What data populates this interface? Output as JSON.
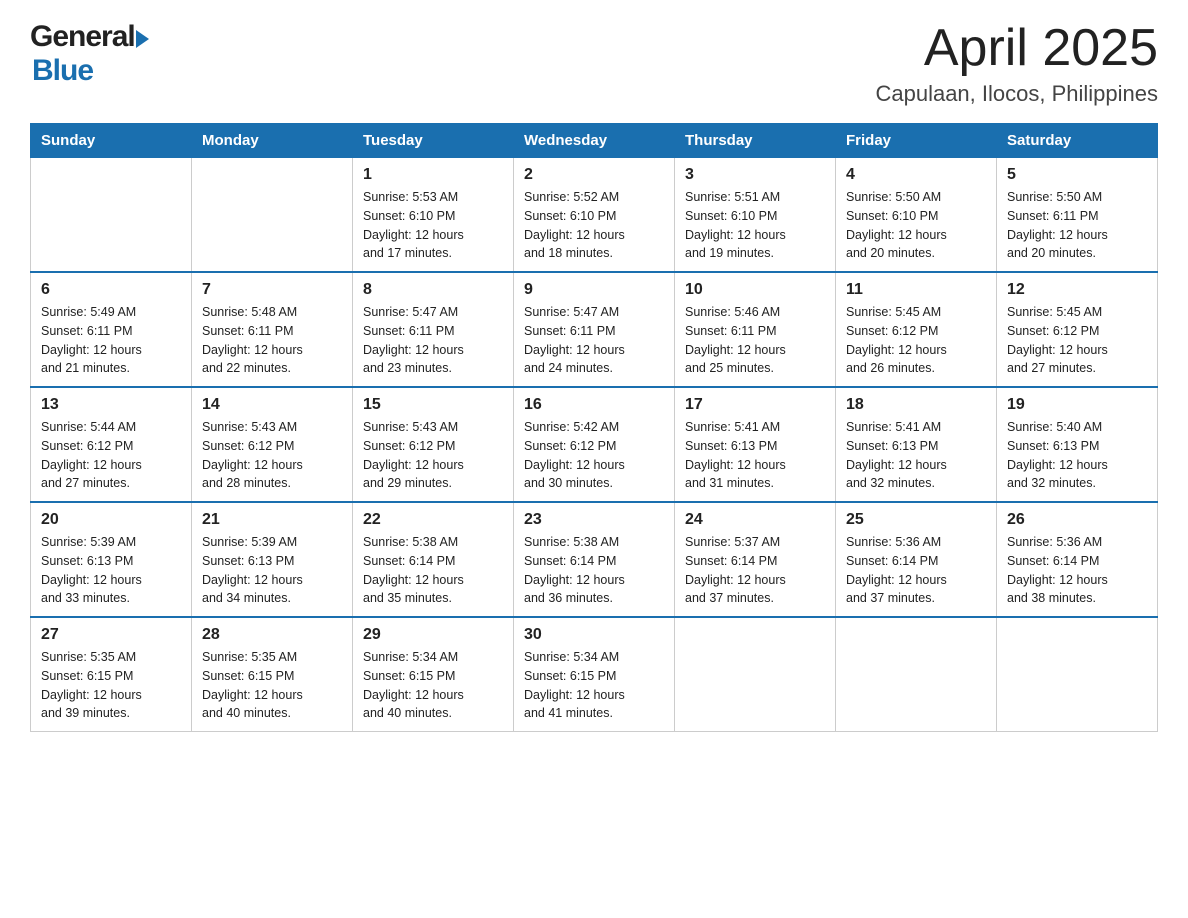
{
  "header": {
    "logo_general": "General",
    "logo_blue": "Blue",
    "title": "April 2025",
    "location": "Capulaan, Ilocos, Philippines"
  },
  "days_of_week": [
    "Sunday",
    "Monday",
    "Tuesday",
    "Wednesday",
    "Thursday",
    "Friday",
    "Saturday"
  ],
  "weeks": [
    [
      {
        "day": "",
        "info": ""
      },
      {
        "day": "",
        "info": ""
      },
      {
        "day": "1",
        "info": "Sunrise: 5:53 AM\nSunset: 6:10 PM\nDaylight: 12 hours\nand 17 minutes."
      },
      {
        "day": "2",
        "info": "Sunrise: 5:52 AM\nSunset: 6:10 PM\nDaylight: 12 hours\nand 18 minutes."
      },
      {
        "day": "3",
        "info": "Sunrise: 5:51 AM\nSunset: 6:10 PM\nDaylight: 12 hours\nand 19 minutes."
      },
      {
        "day": "4",
        "info": "Sunrise: 5:50 AM\nSunset: 6:10 PM\nDaylight: 12 hours\nand 20 minutes."
      },
      {
        "day": "5",
        "info": "Sunrise: 5:50 AM\nSunset: 6:11 PM\nDaylight: 12 hours\nand 20 minutes."
      }
    ],
    [
      {
        "day": "6",
        "info": "Sunrise: 5:49 AM\nSunset: 6:11 PM\nDaylight: 12 hours\nand 21 minutes."
      },
      {
        "day": "7",
        "info": "Sunrise: 5:48 AM\nSunset: 6:11 PM\nDaylight: 12 hours\nand 22 minutes."
      },
      {
        "day": "8",
        "info": "Sunrise: 5:47 AM\nSunset: 6:11 PM\nDaylight: 12 hours\nand 23 minutes."
      },
      {
        "day": "9",
        "info": "Sunrise: 5:47 AM\nSunset: 6:11 PM\nDaylight: 12 hours\nand 24 minutes."
      },
      {
        "day": "10",
        "info": "Sunrise: 5:46 AM\nSunset: 6:11 PM\nDaylight: 12 hours\nand 25 minutes."
      },
      {
        "day": "11",
        "info": "Sunrise: 5:45 AM\nSunset: 6:12 PM\nDaylight: 12 hours\nand 26 minutes."
      },
      {
        "day": "12",
        "info": "Sunrise: 5:45 AM\nSunset: 6:12 PM\nDaylight: 12 hours\nand 27 minutes."
      }
    ],
    [
      {
        "day": "13",
        "info": "Sunrise: 5:44 AM\nSunset: 6:12 PM\nDaylight: 12 hours\nand 27 minutes."
      },
      {
        "day": "14",
        "info": "Sunrise: 5:43 AM\nSunset: 6:12 PM\nDaylight: 12 hours\nand 28 minutes."
      },
      {
        "day": "15",
        "info": "Sunrise: 5:43 AM\nSunset: 6:12 PM\nDaylight: 12 hours\nand 29 minutes."
      },
      {
        "day": "16",
        "info": "Sunrise: 5:42 AM\nSunset: 6:12 PM\nDaylight: 12 hours\nand 30 minutes."
      },
      {
        "day": "17",
        "info": "Sunrise: 5:41 AM\nSunset: 6:13 PM\nDaylight: 12 hours\nand 31 minutes."
      },
      {
        "day": "18",
        "info": "Sunrise: 5:41 AM\nSunset: 6:13 PM\nDaylight: 12 hours\nand 32 minutes."
      },
      {
        "day": "19",
        "info": "Sunrise: 5:40 AM\nSunset: 6:13 PM\nDaylight: 12 hours\nand 32 minutes."
      }
    ],
    [
      {
        "day": "20",
        "info": "Sunrise: 5:39 AM\nSunset: 6:13 PM\nDaylight: 12 hours\nand 33 minutes."
      },
      {
        "day": "21",
        "info": "Sunrise: 5:39 AM\nSunset: 6:13 PM\nDaylight: 12 hours\nand 34 minutes."
      },
      {
        "day": "22",
        "info": "Sunrise: 5:38 AM\nSunset: 6:14 PM\nDaylight: 12 hours\nand 35 minutes."
      },
      {
        "day": "23",
        "info": "Sunrise: 5:38 AM\nSunset: 6:14 PM\nDaylight: 12 hours\nand 36 minutes."
      },
      {
        "day": "24",
        "info": "Sunrise: 5:37 AM\nSunset: 6:14 PM\nDaylight: 12 hours\nand 37 minutes."
      },
      {
        "day": "25",
        "info": "Sunrise: 5:36 AM\nSunset: 6:14 PM\nDaylight: 12 hours\nand 37 minutes."
      },
      {
        "day": "26",
        "info": "Sunrise: 5:36 AM\nSunset: 6:14 PM\nDaylight: 12 hours\nand 38 minutes."
      }
    ],
    [
      {
        "day": "27",
        "info": "Sunrise: 5:35 AM\nSunset: 6:15 PM\nDaylight: 12 hours\nand 39 minutes."
      },
      {
        "day": "28",
        "info": "Sunrise: 5:35 AM\nSunset: 6:15 PM\nDaylight: 12 hours\nand 40 minutes."
      },
      {
        "day": "29",
        "info": "Sunrise: 5:34 AM\nSunset: 6:15 PM\nDaylight: 12 hours\nand 40 minutes."
      },
      {
        "day": "30",
        "info": "Sunrise: 5:34 AM\nSunset: 6:15 PM\nDaylight: 12 hours\nand 41 minutes."
      },
      {
        "day": "",
        "info": ""
      },
      {
        "day": "",
        "info": ""
      },
      {
        "day": "",
        "info": ""
      }
    ]
  ]
}
